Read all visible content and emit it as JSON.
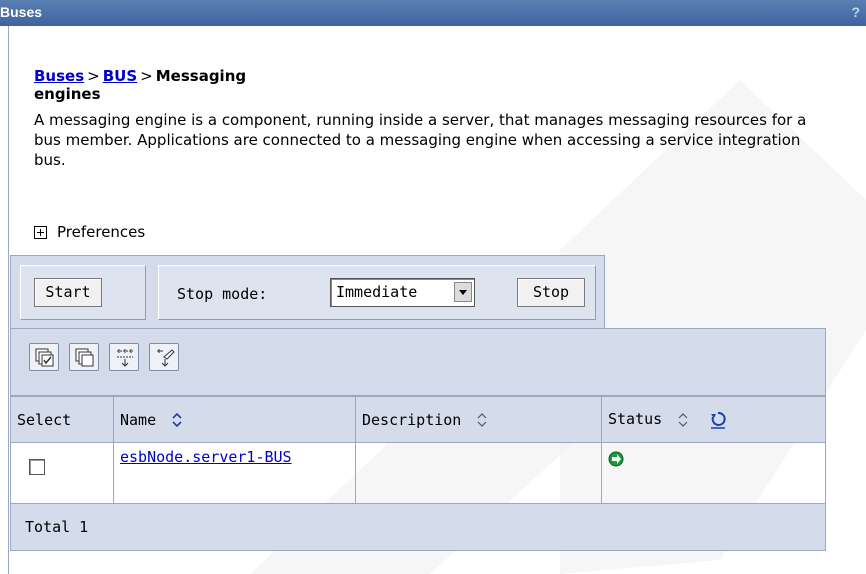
{
  "window": {
    "title": "Buses",
    "help_label": "?"
  },
  "breadcrumb": {
    "items": [
      {
        "label": "Buses",
        "link": true
      },
      {
        "label": "BUS",
        "link": true
      },
      {
        "label": "Messaging engines",
        "link": false
      }
    ],
    "separator": ">"
  },
  "description": "A messaging engine is a component, running inside a server, that manages messaging resources for a bus member. Applications are connected to a messaging engine when accessing a service integration bus.",
  "preferences": {
    "label": "Preferences",
    "icon": "expand-plus-icon"
  },
  "toolbar": {
    "start_label": "Start",
    "stop_mode_label": "Stop mode:",
    "stop_mode_value": "Immediate",
    "stop_label": "Stop"
  },
  "icon_buttons": [
    {
      "name": "select-all-icon"
    },
    {
      "name": "deselect-all-icon"
    },
    {
      "name": "show-filter-icon"
    },
    {
      "name": "clear-filter-icon"
    }
  ],
  "table": {
    "columns": [
      {
        "label": "Select",
        "sortable": false
      },
      {
        "label": "Name",
        "sortable": true
      },
      {
        "label": "Description",
        "sortable": true
      },
      {
        "label": "Status",
        "sortable": true,
        "refresh": true
      }
    ],
    "rows": [
      {
        "name": "esbNode.server1-BUS",
        "description": "",
        "status": "started",
        "status_color": "#1a9a3a"
      }
    ],
    "total_label": "Total 1"
  },
  "colors": {
    "link": "#0000cc",
    "titlebar": "#4a6ea8",
    "panel": "#d4dceb",
    "status_started": "#1a9a3a"
  }
}
